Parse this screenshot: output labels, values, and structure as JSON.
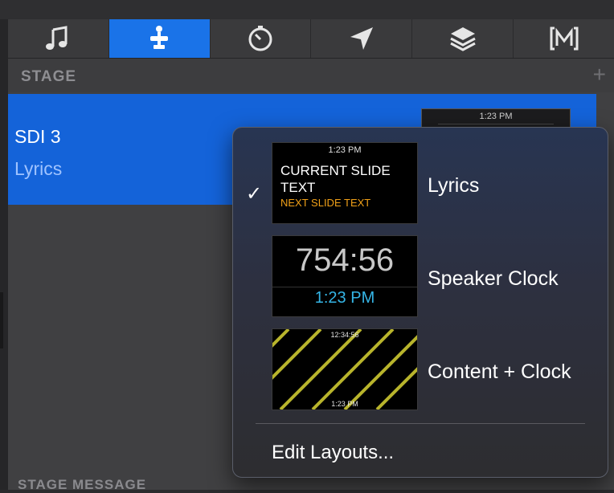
{
  "tabs": [
    {
      "icon": "music-note-icon"
    },
    {
      "icon": "stage-display-icon",
      "active": true
    },
    {
      "icon": "timer-icon"
    },
    {
      "icon": "navigation-arrow-icon"
    },
    {
      "icon": "layers-icon"
    },
    {
      "icon": "macro-m-icon"
    }
  ],
  "stage": {
    "title": "STAGE",
    "add_glyph": "+",
    "row": {
      "name": "SDI 3",
      "layout": "Lyrics",
      "thumb_time": "1:23 PM"
    }
  },
  "bottom_label": "STAGE MESSAGE",
  "dropdown": {
    "checkmark": "✓",
    "items": [
      {
        "label": "Lyrics",
        "selected": true,
        "thumb": {
          "time": "1:23 PM",
          "current": "CURRENT SLIDE TEXT",
          "next": "NEXT SLIDE TEXT"
        }
      },
      {
        "label": "Speaker Clock",
        "thumb": {
          "big": "754:56",
          "small": "1:23 PM"
        }
      },
      {
        "label": "Content + Clock",
        "thumb": {
          "top": "12:34:56",
          "bottom": "1:23 PM"
        }
      }
    ],
    "edit_label": "Edit Layouts..."
  },
  "colors": {
    "accent": "#1a73e8",
    "selection": "#1463d9",
    "next_text": "#f0a018",
    "clock_small": "#35b5e6",
    "stripes": "#b8b42c"
  }
}
